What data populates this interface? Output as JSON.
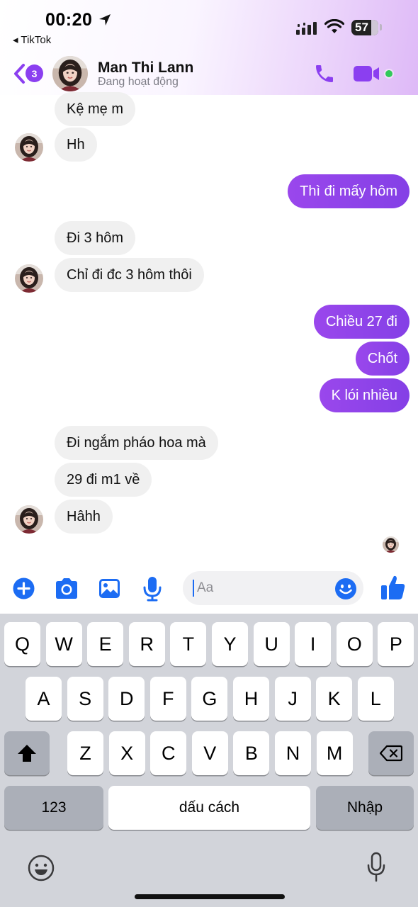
{
  "status_bar": {
    "time": "00:20",
    "back_app": "◂ TikTok",
    "battery": "57"
  },
  "header": {
    "unread_count": "3",
    "contact_name": "Man Thi Lann",
    "contact_status": "Đang hoạt động"
  },
  "messages": [
    {
      "side": "in",
      "text": "Kệ mẹ m"
    },
    {
      "side": "in",
      "text": "Hh"
    },
    {
      "side": "out",
      "text": "Thì đi mấy hôm"
    },
    {
      "side": "in",
      "text": "Đi 3 hôm"
    },
    {
      "side": "in",
      "text": "Chỉ đi đc 3 hôm thôi"
    },
    {
      "side": "out",
      "text": "Chiều 27 đi"
    },
    {
      "side": "out",
      "text": "Chốt"
    },
    {
      "side": "out",
      "text": "K lói nhiều"
    },
    {
      "side": "in",
      "text": "Đi ngắm pháo hoa mà"
    },
    {
      "side": "in",
      "text": "29 đi m1 về"
    },
    {
      "side": "in",
      "text": "Hâhh"
    }
  ],
  "composer": {
    "placeholder": "Aa",
    "icons": [
      "plus-icon",
      "camera-icon",
      "image-icon",
      "microphone-icon",
      "emoji-icon",
      "like-icon"
    ]
  },
  "keyboard": {
    "row1": [
      "Q",
      "W",
      "E",
      "R",
      "T",
      "Y",
      "U",
      "I",
      "O",
      "P"
    ],
    "row2": [
      "A",
      "S",
      "D",
      "F",
      "G",
      "H",
      "J",
      "K",
      "L"
    ],
    "row3": [
      "Z",
      "X",
      "C",
      "V",
      "B",
      "N",
      "M"
    ],
    "numbers_label": "123",
    "space_label": "dấu cách",
    "return_label": "Nhập"
  },
  "colors": {
    "accent": "#8b3ff0",
    "outgoing_bubble": "#8d43e9",
    "incoming_bubble": "#f0f0f0",
    "composer_icon": "#1c6cf3",
    "online_dot": "#31c95a"
  }
}
